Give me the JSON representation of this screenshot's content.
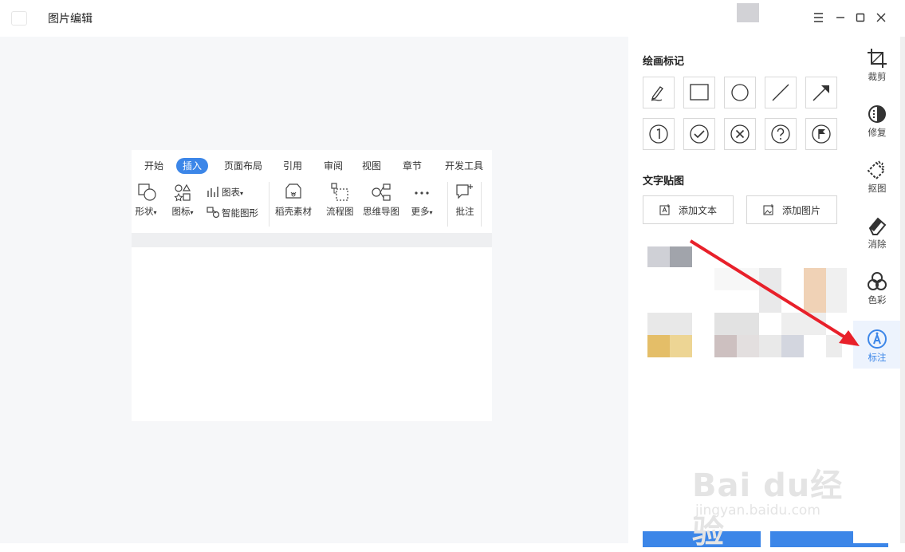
{
  "window": {
    "title": "图片编辑"
  },
  "ribbon": {
    "tabs": [
      "开始",
      "插入",
      "页面布局",
      "引用",
      "审阅",
      "视图",
      "章节",
      "开发工具"
    ],
    "active_tab": "插入",
    "tools": {
      "shape": "形状",
      "icon": "图标",
      "chart": "图表",
      "smart_graphic": "智能图形",
      "material": "稻壳素材",
      "flowchart": "流程图",
      "mindmap": "思维导图",
      "more": "更多",
      "comment": "批注"
    }
  },
  "panel": {
    "drawing_title": "绘画标记",
    "text_sticker_title": "文字贴图",
    "add_text": "添加文本",
    "add_image": "添加图片"
  },
  "side_nav": [
    {
      "label": "裁剪",
      "icon": "crop-icon"
    },
    {
      "label": "修复",
      "icon": "repair-icon"
    },
    {
      "label": "抠图",
      "icon": "cutout-icon"
    },
    {
      "label": "消除",
      "icon": "eraser-icon"
    },
    {
      "label": "色彩",
      "icon": "color-icon"
    },
    {
      "label": "标注",
      "icon": "annotate-icon"
    }
  ],
  "active_nav": "标注",
  "watermark": {
    "brand": "Bai du经验",
    "sub": "jingyan.baidu.com"
  },
  "colors": {
    "accent": "#3c86e8",
    "arrow": "#e8202a"
  }
}
